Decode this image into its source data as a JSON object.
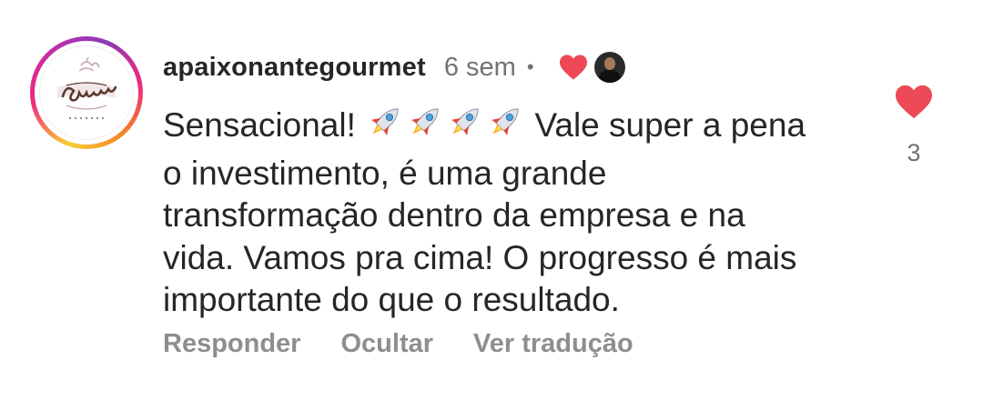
{
  "comment": {
    "username": "apaixonantegourmet",
    "time": "6 sem",
    "separator": "•",
    "text_lines": [
      "Sensacional!",
      "Vale super a pena",
      "o investimento, é uma grande",
      "transformação dentro da empresa e na",
      "vida. Vamos pra cima! O progresso é mais",
      "importante do que o resultado."
    ],
    "emoji": "rocket-emoji",
    "emoji_count": 4,
    "liked_by_creator": true
  },
  "avatar": {
    "logo_top": "apaixonante",
    "logo_main": "Gourmet",
    "logo_sub": "Confeitaria",
    "ring_colors": [
      "#f9ce34",
      "#ee2a7b",
      "#8a3ab9"
    ]
  },
  "like": {
    "count": "3",
    "liked": true,
    "color": "#ed4956"
  },
  "actions": {
    "reply": "Responder",
    "hide": "Ocultar",
    "translate": "Ver tradução"
  }
}
